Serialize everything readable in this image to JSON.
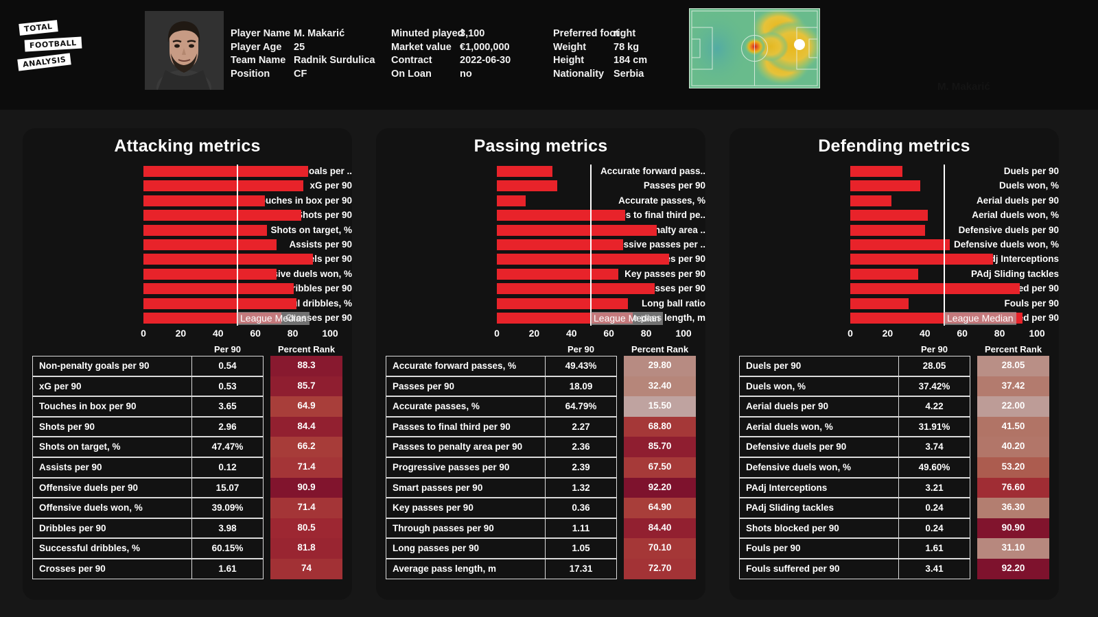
{
  "header": {
    "logo": {
      "line1": "TOTAL",
      "line2": "FOOTBALL",
      "line3": "ANALYSIS"
    },
    "watermark": "M. Makarić",
    "portrait_alt": "player-portrait",
    "heatmap_alt": "player-heatmap",
    "info_columns": [
      [
        {
          "key": "Player Name",
          "sep": ":",
          "value": "M. Makarić"
        },
        {
          "key": "Player Age",
          "sep": ":",
          "value": "25"
        },
        {
          "key": "Team Name",
          "sep": ":",
          "value": "Radnik Surdulica"
        },
        {
          "key": "Position",
          "sep": ":",
          "value": "CF"
        }
      ],
      [
        {
          "key": "Minuted played",
          "sep": ":",
          "value": "3,100"
        },
        {
          "key": "Market value",
          "sep": ":",
          "value": "€1,000,000"
        },
        {
          "key": "Contract",
          "sep": ":",
          "value": "2022-06-30"
        },
        {
          "key": "On Loan",
          "sep": ":",
          "value": "no"
        }
      ],
      [
        {
          "key": "Preferred foot",
          "sep": ":",
          "value": "right"
        },
        {
          "key": "Weight",
          "sep": ":",
          "value": "78 kg"
        },
        {
          "key": "Height",
          "sep": ":",
          "value": "184 cm"
        },
        {
          "key": "Nationality",
          "sep": ":",
          "value": "Serbia"
        }
      ]
    ]
  },
  "common": {
    "median_label": "League Median",
    "col_metric": "",
    "col_per90": "Per 90",
    "col_rank": "Percent Rank",
    "xticks": [
      "0",
      "20",
      "40",
      "60",
      "80",
      "100"
    ],
    "bar_color": "#e8232a",
    "median_color": "#ffffff"
  },
  "chart_data": [
    {
      "type": "bar",
      "title": "Attacking metrics",
      "xlabel": "",
      "ylabel": "",
      "xlim": [
        0,
        100
      ],
      "orientation": "horizontal",
      "grid": false,
      "median": 50,
      "median_annotation": "League Median",
      "categories": [
        "Non-penalty goals per ..",
        "xG per 90",
        "Touches in box per 90",
        "Shots per 90",
        "Shots on target, %",
        "Assists per 90",
        "Offensive duels per 90",
        "Offensive duels won, %",
        "Dribbles per 90",
        "Successful dribbles, %",
        "Crosses per 90"
      ],
      "values": [
        88.3,
        85.7,
        64.9,
        84.4,
        66.2,
        71.4,
        90.9,
        71.4,
        80.5,
        81.8,
        74
      ],
      "table": {
        "rows": [
          {
            "metric": "Non-penalty goals per 90",
            "per90": "0.54",
            "rank": "88.3",
            "rank_value": 88.3
          },
          {
            "metric": "xG per 90",
            "per90": "0.53",
            "rank": "85.7",
            "rank_value": 85.7
          },
          {
            "metric": "Touches in box per 90",
            "per90": "3.65",
            "rank": "64.9",
            "rank_value": 64.9
          },
          {
            "metric": "Shots per 90",
            "per90": "2.96",
            "rank": "84.4",
            "rank_value": 84.4
          },
          {
            "metric": "Shots on target, %",
            "per90": "47.47%",
            "rank": "66.2",
            "rank_value": 66.2
          },
          {
            "metric": "Assists per 90",
            "per90": "0.12",
            "rank": "71.4",
            "rank_value": 71.4
          },
          {
            "metric": "Offensive duels per 90",
            "per90": "15.07",
            "rank": "90.9",
            "rank_value": 90.9
          },
          {
            "metric": "Offensive duels won, %",
            "per90": "39.09%",
            "rank": "71.4",
            "rank_value": 71.4
          },
          {
            "metric": "Dribbles per 90",
            "per90": "3.98",
            "rank": "80.5",
            "rank_value": 80.5
          },
          {
            "metric": "Successful dribbles, %",
            "per90": "60.15%",
            "rank": "81.8",
            "rank_value": 81.8
          },
          {
            "metric": "Crosses per 90",
            "per90": "1.61",
            "rank": "74",
            "rank_value": 74.0
          }
        ]
      }
    },
    {
      "type": "bar",
      "title": "Passing metrics",
      "xlabel": "",
      "ylabel": "",
      "xlim": [
        0,
        100
      ],
      "orientation": "horizontal",
      "grid": false,
      "median": 50,
      "median_annotation": "League Median",
      "categories": [
        "Accurate forward pass..",
        "Passes per 90",
        "Accurate passes, %",
        "Passes to final third pe..",
        "Passes to penalty area ..",
        "Progressive passes per ..",
        "Smart passes per 90",
        "Key passes per 90",
        "Through passes per 90",
        "Long ball ratio",
        "Average pass length, m"
      ],
      "values": [
        29.8,
        32.4,
        15.5,
        68.8,
        85.7,
        67.5,
        92.2,
        64.9,
        84.4,
        70.1,
        72.7
      ],
      "table": {
        "rows": [
          {
            "metric": "Accurate forward passes, %",
            "per90": "49.43%",
            "rank": "29.80",
            "rank_value": 29.8
          },
          {
            "metric": "Passes per 90",
            "per90": "18.09",
            "rank": "32.40",
            "rank_value": 32.4
          },
          {
            "metric": "Accurate passes, %",
            "per90": "64.79%",
            "rank": "15.50",
            "rank_value": 15.5
          },
          {
            "metric": "Passes to final third per 90",
            "per90": "2.27",
            "rank": "68.80",
            "rank_value": 68.8
          },
          {
            "metric": "Passes to penalty area per 90",
            "per90": "2.36",
            "rank": "85.70",
            "rank_value": 85.7
          },
          {
            "metric": "Progressive passes per 90",
            "per90": "2.39",
            "rank": "67.50",
            "rank_value": 67.5
          },
          {
            "metric": "Smart passes per 90",
            "per90": "1.32",
            "rank": "92.20",
            "rank_value": 92.2
          },
          {
            "metric": "Key passes per 90",
            "per90": "0.36",
            "rank": "64.90",
            "rank_value": 64.9
          },
          {
            "metric": "Through passes per 90",
            "per90": "1.11",
            "rank": "84.40",
            "rank_value": 84.4
          },
          {
            "metric": "Long passes per 90",
            "per90": "1.05",
            "rank": "70.10",
            "rank_value": 70.1
          },
          {
            "metric": "Average pass length, m",
            "per90": "17.31",
            "rank": "72.70",
            "rank_value": 72.7
          }
        ]
      }
    },
    {
      "type": "bar",
      "title": "Defending metrics",
      "xlabel": "",
      "ylabel": "",
      "xlim": [
        0,
        100
      ],
      "orientation": "horizontal",
      "grid": false,
      "median": 50,
      "median_annotation": "League Median",
      "categories": [
        "Duels per 90",
        "Duels won, %",
        "Aerial duels per 90",
        "Aerial duels won, %",
        "Defensive duels per 90",
        "Defensive duels won, %",
        "PAdj Interceptions",
        "PAdj Sliding tackles",
        "Shots blocked per 90",
        "Fouls per 90",
        "Fouls suffered per 90"
      ],
      "values": [
        28.05,
        37.42,
        22.0,
        41.5,
        40.2,
        53.2,
        76.6,
        36.3,
        90.9,
        31.1,
        92.2
      ],
      "table": {
        "rows": [
          {
            "metric": "Duels per 90",
            "per90": "28.05",
            "rank": "28.05",
            "rank_value": 28.05
          },
          {
            "metric": "Duels won, %",
            "per90": "37.42%",
            "rank": "37.42",
            "rank_value": 37.42
          },
          {
            "metric": "Aerial duels per 90",
            "per90": "4.22",
            "rank": "22.00",
            "rank_value": 22.0
          },
          {
            "metric": "Aerial duels won, %",
            "per90": "31.91%",
            "rank": "41.50",
            "rank_value": 41.5
          },
          {
            "metric": "Defensive duels per 90",
            "per90": "3.74",
            "rank": "40.20",
            "rank_value": 40.2
          },
          {
            "metric": "Defensive duels won, %",
            "per90": "49.60%",
            "rank": "53.20",
            "rank_value": 53.2
          },
          {
            "metric": "PAdj Interceptions",
            "per90": "3.21",
            "rank": "76.60",
            "rank_value": 76.6
          },
          {
            "metric": "PAdj Sliding tackles",
            "per90": "0.24",
            "rank": "36.30",
            "rank_value": 36.3
          },
          {
            "metric": "Shots blocked per 90",
            "per90": "0.24",
            "rank": "90.90",
            "rank_value": 90.9
          },
          {
            "metric": "Fouls per 90",
            "per90": "1.61",
            "rank": "31.10",
            "rank_value": 31.1
          },
          {
            "metric": "Fouls suffered per 90",
            "per90": "3.41",
            "rank": "92.20",
            "rank_value": 92.2
          }
        ]
      }
    }
  ]
}
